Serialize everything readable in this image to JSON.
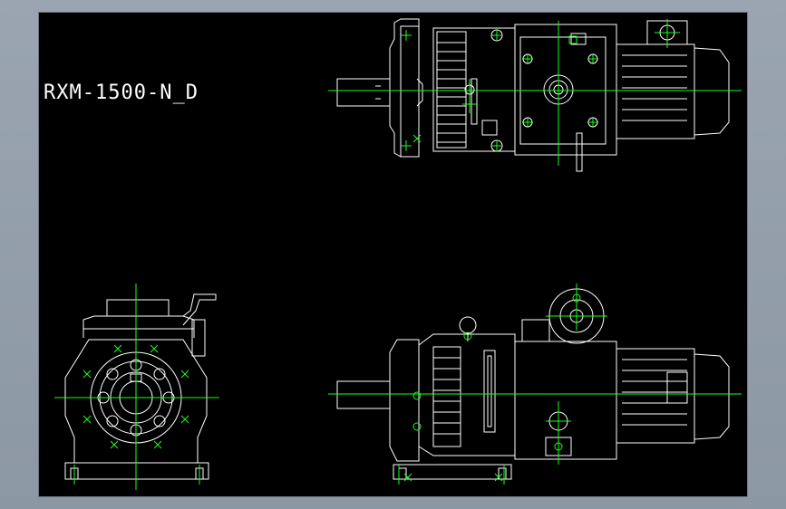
{
  "drawing": {
    "title": "RXM-1500-N_D"
  },
  "colors": {
    "canvas_background": "#000000",
    "outer_background": "#909ba8",
    "outline": "#ffffff",
    "centerline": "#19ff19"
  },
  "views": [
    {
      "id": "top-view"
    },
    {
      "id": "end-view"
    },
    {
      "id": "side-view"
    }
  ]
}
